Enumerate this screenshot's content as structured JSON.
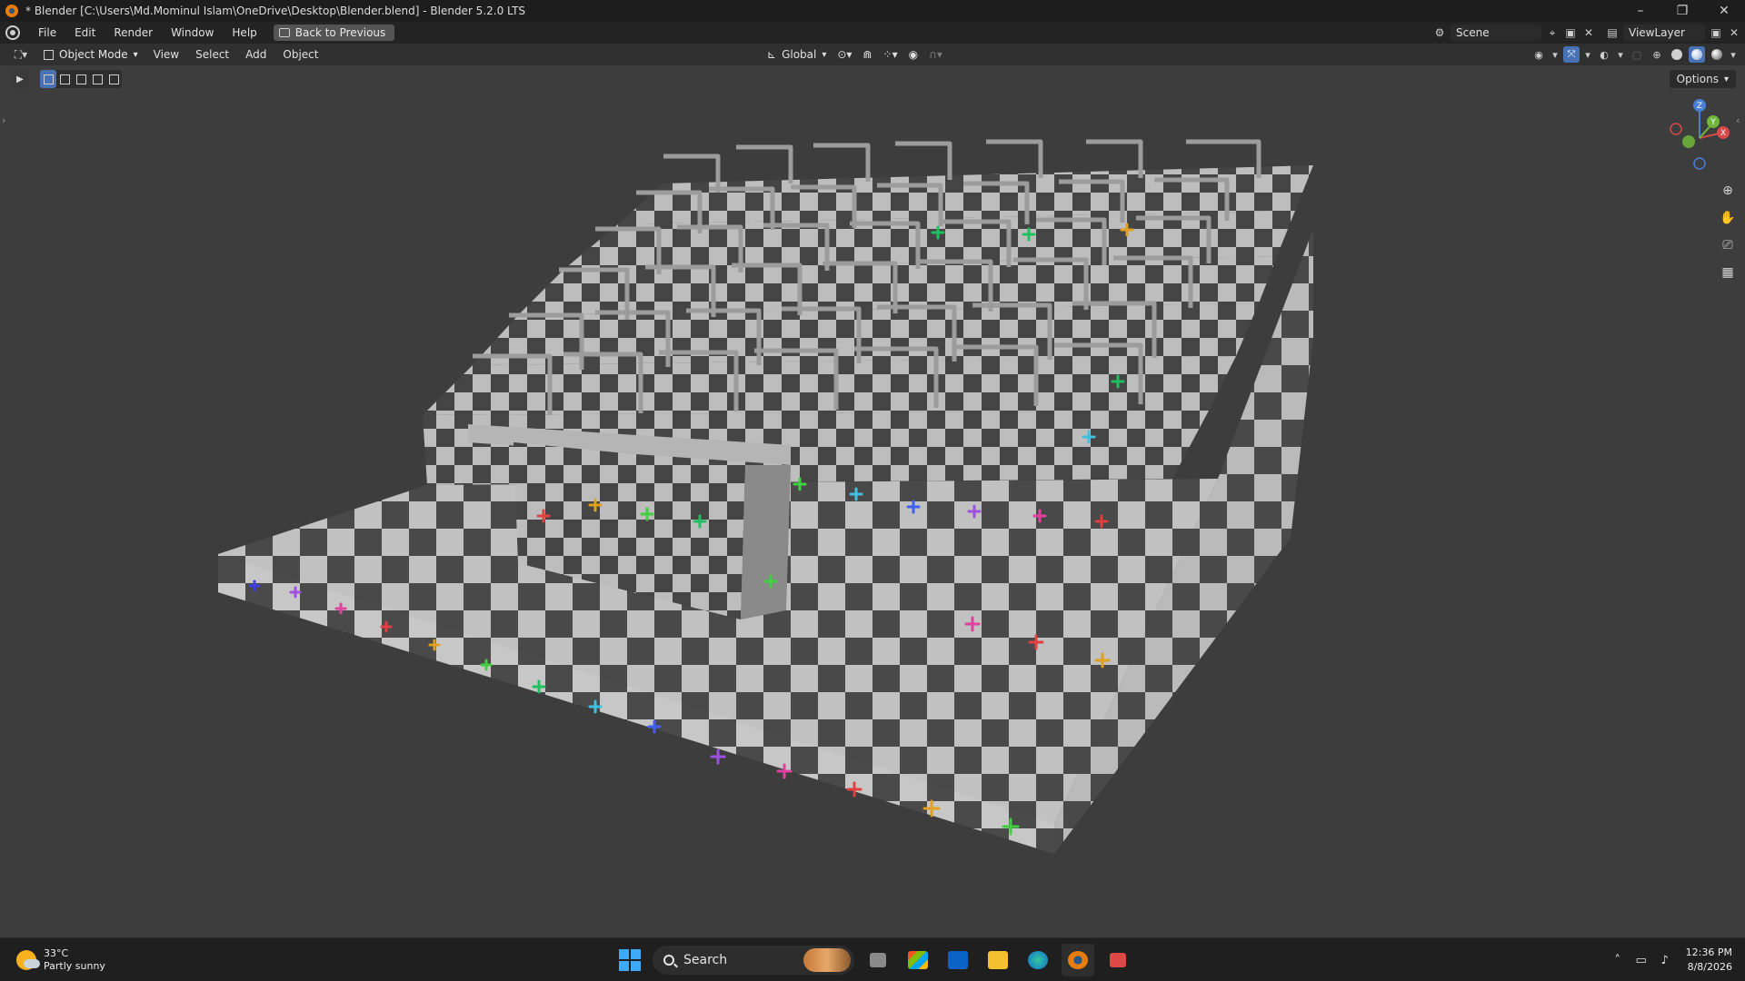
{
  "window": {
    "title": "* Blender [C:\\Users\\Md.Mominul Islam\\OneDrive\\Desktop\\Blender.blend] - Blender 5.2.0 LTS",
    "controls": {
      "minimize": "–",
      "restore": "❐",
      "close": "✕"
    }
  },
  "menubar": {
    "items": [
      "File",
      "Edit",
      "Render",
      "Window",
      "Help"
    ],
    "back_button": "Back to Previous",
    "scene_name": "Scene",
    "view_layer": "ViewLayer"
  },
  "viewport_header": {
    "mode": "Object Mode",
    "menus": [
      "View",
      "Select",
      "Add",
      "Object"
    ],
    "transform_orientation": "Global",
    "options_label": "Options"
  },
  "gizmo": {
    "x": "X",
    "y": "Y",
    "z": "Z"
  },
  "taskbar": {
    "weather_temp": "33°C",
    "weather_desc": "Partly sunny",
    "search_label": "Search",
    "time": "12:36 PM",
    "date": "8/8/2026"
  },
  "colors": {
    "accent": "#4772b3",
    "checker_light": "#c8c8c8",
    "checker_dark": "#4a4a4a",
    "viewport_bg": "#3d3d3d"
  }
}
